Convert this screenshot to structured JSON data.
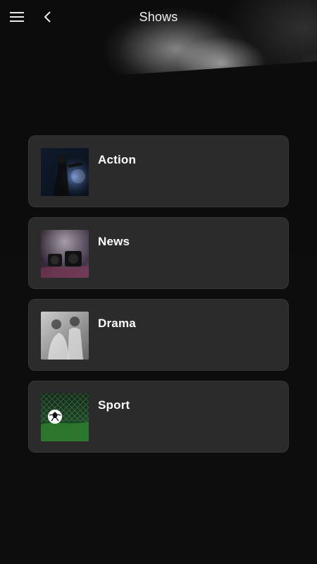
{
  "header": {
    "title": "Shows",
    "menu_icon": "hamburger-menu-icon",
    "back_icon": "chevron-left-icon"
  },
  "categories": [
    {
      "label": "Action",
      "thumbnail": "action-thumbnail"
    },
    {
      "label": "News",
      "thumbnail": "news-thumbnail"
    },
    {
      "label": "Drama",
      "thumbnail": "drama-thumbnail"
    },
    {
      "label": "Sport",
      "thumbnail": "sport-thumbnail"
    }
  ],
  "theme": {
    "background": "#0d0d0d",
    "card_background": "#2b2b2b",
    "text": "#ffffff"
  }
}
